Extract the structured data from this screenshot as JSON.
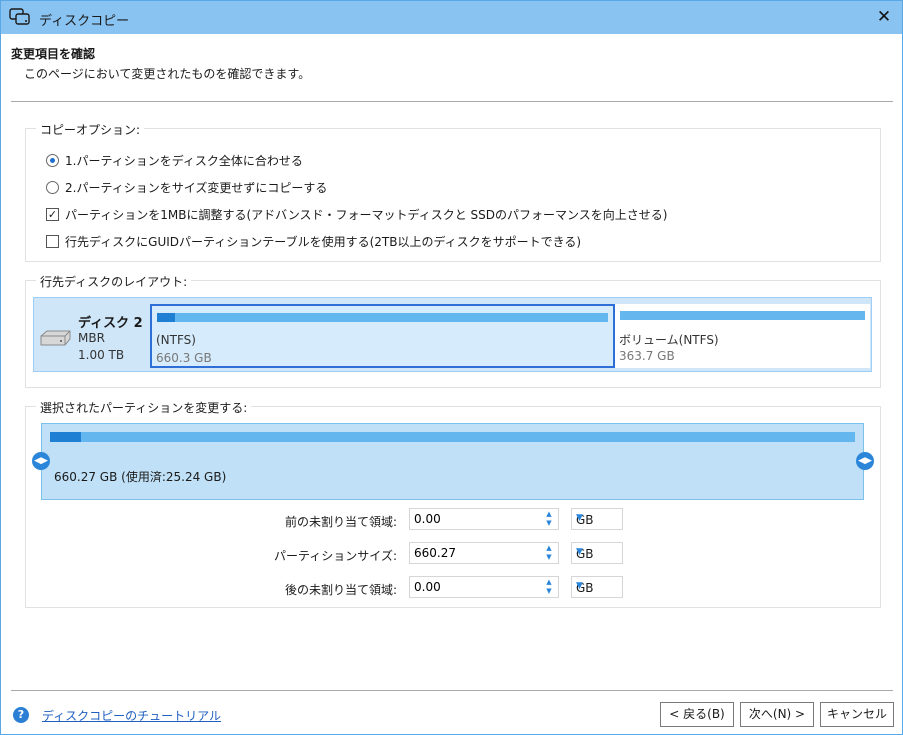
{
  "window": {
    "title": "ディスクコピー",
    "close_label": "✕"
  },
  "header": {
    "title": "変更項目を確認",
    "subtitle": "このページにおいて変更されたものを確認できます。"
  },
  "copy_options": {
    "label": "コピーオプション:",
    "options": [
      {
        "label": "1.パーティションをディスク全体に合わせる",
        "type": "radio",
        "checked": true
      },
      {
        "label": "2.パーティションをサイズ変更せずにコピーする",
        "type": "radio",
        "checked": false
      },
      {
        "label": "パーティションを1MBに調整する(アドバンスド・フォーマットディスクと SSDのパフォーマンスを向上させる)",
        "type": "checkbox",
        "checked": true
      },
      {
        "label": "行先ディスクにGUIDパーティションテーブルを使用する(2TB以上のディスクをサポートできる)",
        "type": "checkbox",
        "checked": false
      }
    ]
  },
  "layout": {
    "label": "行先ディスクのレイアウト:",
    "disk": {
      "name": "ディスク 2",
      "type": "MBR",
      "size": "1.00 TB"
    },
    "partitions": [
      {
        "name": "(NTFS)",
        "size": "660.3 GB",
        "used_fraction": 0.04,
        "selected": true
      },
      {
        "name": "ボリューム(NTFS)",
        "size": "363.7 GB",
        "used_fraction": 0.0,
        "selected": false
      }
    ]
  },
  "resize": {
    "label": "選択されたパーティションを変更する:",
    "summary": "660.27 GB (使用済:25.24 GB)",
    "used_fraction": 0.038,
    "fields": [
      {
        "label": "前の未割り当て領域:",
        "value": "0.00",
        "unit": "GB"
      },
      {
        "label": "パーティションサイズ:",
        "value": "660.27",
        "unit": "GB"
      },
      {
        "label": "後の未割り当て領域:",
        "value": "0.00",
        "unit": "GB"
      }
    ]
  },
  "footer": {
    "help_link": "ディスクコピーのチュートリアル",
    "back_button": "< 戻る(B)",
    "next_button": "次へ(N) >",
    "cancel_button": "キャンセル"
  },
  "colors": {
    "titlebar": "#89c3f1",
    "accent": "#2b86d9",
    "selected_border": "#2d6fd6"
  }
}
